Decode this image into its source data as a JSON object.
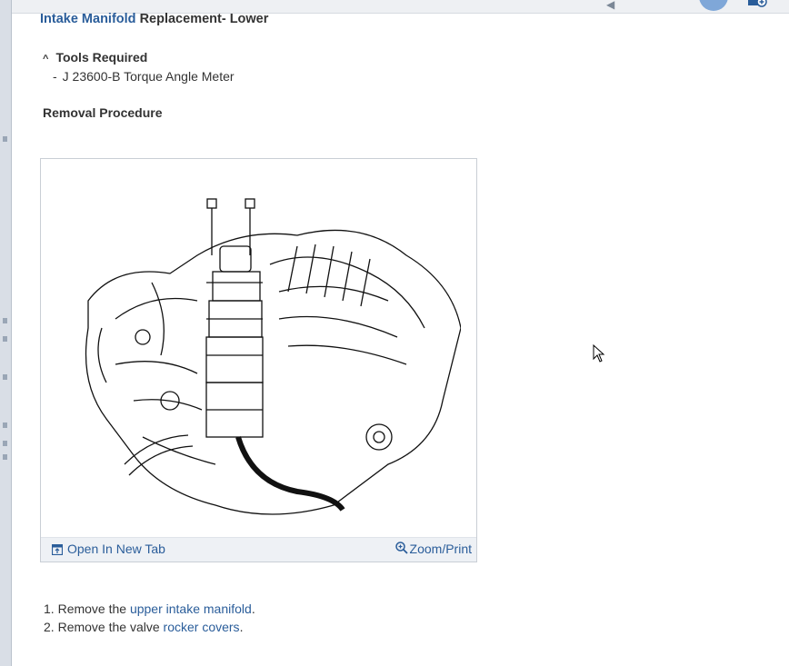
{
  "document": {
    "title_link": "Intake Manifold",
    "title_rest": " Replacement- Lower",
    "tools": {
      "caret": "^",
      "heading": "Tools Required",
      "items": [
        {
          "dash": "-",
          "text": "J 23600-B Torque Angle Meter"
        }
      ]
    },
    "section_heading": "Removal Procedure",
    "figure": {
      "open_tab_label": "Open In New Tab",
      "zoom_label": "Zoom/Print"
    },
    "steps": [
      {
        "num": "1.",
        "prefix": "Remove the ",
        "link": "upper intake manifold",
        "suffix": "."
      },
      {
        "num": "2.",
        "prefix": "Remove the valve ",
        "link": "rocker covers",
        "suffix": "."
      }
    ]
  },
  "colors": {
    "link": "#2a5d9a",
    "text": "#333333",
    "figure_footer_bg": "#eef1f5",
    "figure_border": "#c9ced5"
  }
}
